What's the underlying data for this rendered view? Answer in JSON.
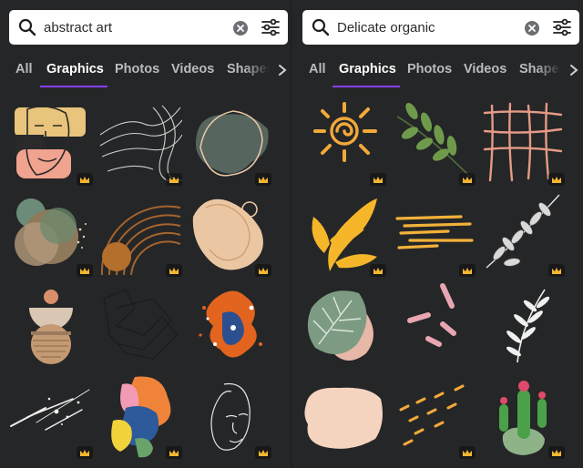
{
  "panels": [
    {
      "search": {
        "value": "abstract art"
      },
      "tabs": [
        "All",
        "Graphics",
        "Photos",
        "Videos",
        "Shapes"
      ],
      "active_tab": "Graphics",
      "results": [
        {
          "name": "face-collage",
          "premium": true
        },
        {
          "name": "wavy-lines",
          "premium": true
        },
        {
          "name": "green-blob",
          "premium": true
        },
        {
          "name": "circle-collage",
          "premium": true
        },
        {
          "name": "rainbow-arcs",
          "premium": true
        },
        {
          "name": "beige-blob",
          "premium": true
        },
        {
          "name": "stacked-shapes",
          "premium": false
        },
        {
          "name": "line-scribble",
          "premium": false
        },
        {
          "name": "paint-splash",
          "premium": false
        },
        {
          "name": "white-splatter",
          "premium": true
        },
        {
          "name": "color-shapes",
          "premium": true
        },
        {
          "name": "line-face",
          "premium": true
        }
      ]
    },
    {
      "search": {
        "value": "Delicate organic"
      },
      "tabs": [
        "All",
        "Graphics",
        "Photos",
        "Videos",
        "Shapes"
      ],
      "active_tab": "Graphics",
      "results": [
        {
          "name": "sun",
          "premium": true
        },
        {
          "name": "green-branch",
          "premium": true
        },
        {
          "name": "grid-lines",
          "premium": true
        },
        {
          "name": "yellow-leaves",
          "premium": true
        },
        {
          "name": "yellow-strokes",
          "premium": true
        },
        {
          "name": "white-branch",
          "premium": true
        },
        {
          "name": "monstera-leaf",
          "premium": false
        },
        {
          "name": "pink-strokes",
          "premium": false
        },
        {
          "name": "white-sprig",
          "premium": false
        },
        {
          "name": "peach-blob",
          "premium": false
        },
        {
          "name": "orange-dashes",
          "premium": true
        },
        {
          "name": "cactus",
          "premium": true
        }
      ]
    }
  ],
  "colors": {
    "background": "#252627",
    "accent": "#8b3dff",
    "tab_active": "#ffffff",
    "tab_inactive": "#b9bcc0",
    "crown": "#f5b731"
  },
  "icons": {
    "search": "search-icon",
    "clear": "clear-icon",
    "filter": "filter-icon",
    "chevron": "chevron-right-icon",
    "crown": "crown-icon"
  }
}
